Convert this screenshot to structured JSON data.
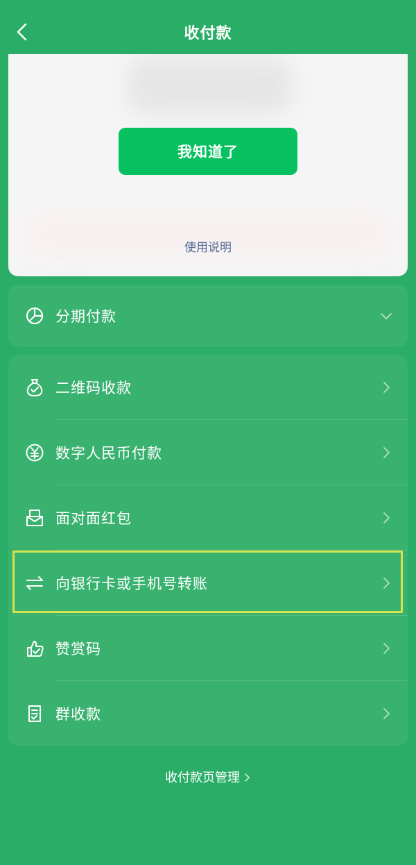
{
  "header": {
    "back_icon": "chevron-left-icon",
    "title": "收付款"
  },
  "top_card": {
    "confirm_button": "我知道了",
    "help_link": "使用说明"
  },
  "installment": {
    "icon": "pie-chart-icon",
    "label": "分期付款",
    "chevron": "chevron-down-icon"
  },
  "menu": {
    "items": [
      {
        "icon": "money-bag-icon",
        "label": "二维码收款"
      },
      {
        "icon": "digital-yuan-icon",
        "label": "数字人民币付款"
      },
      {
        "icon": "red-packet-icon",
        "label": "面对面红包"
      },
      {
        "icon": "transfer-arrows-icon",
        "label": "向银行卡或手机号转账",
        "highlighted": true
      },
      {
        "icon": "thumbs-up-icon",
        "label": "赞赏码"
      },
      {
        "icon": "group-bill-icon",
        "label": "群收款"
      }
    ]
  },
  "footer": {
    "manage_link": "收付款页管理"
  },
  "colors": {
    "background": "#2aae67",
    "panel": "#3ab26f",
    "primary_button": "#07c160",
    "link": "#566b95",
    "highlight_border": "#d6e24a"
  }
}
